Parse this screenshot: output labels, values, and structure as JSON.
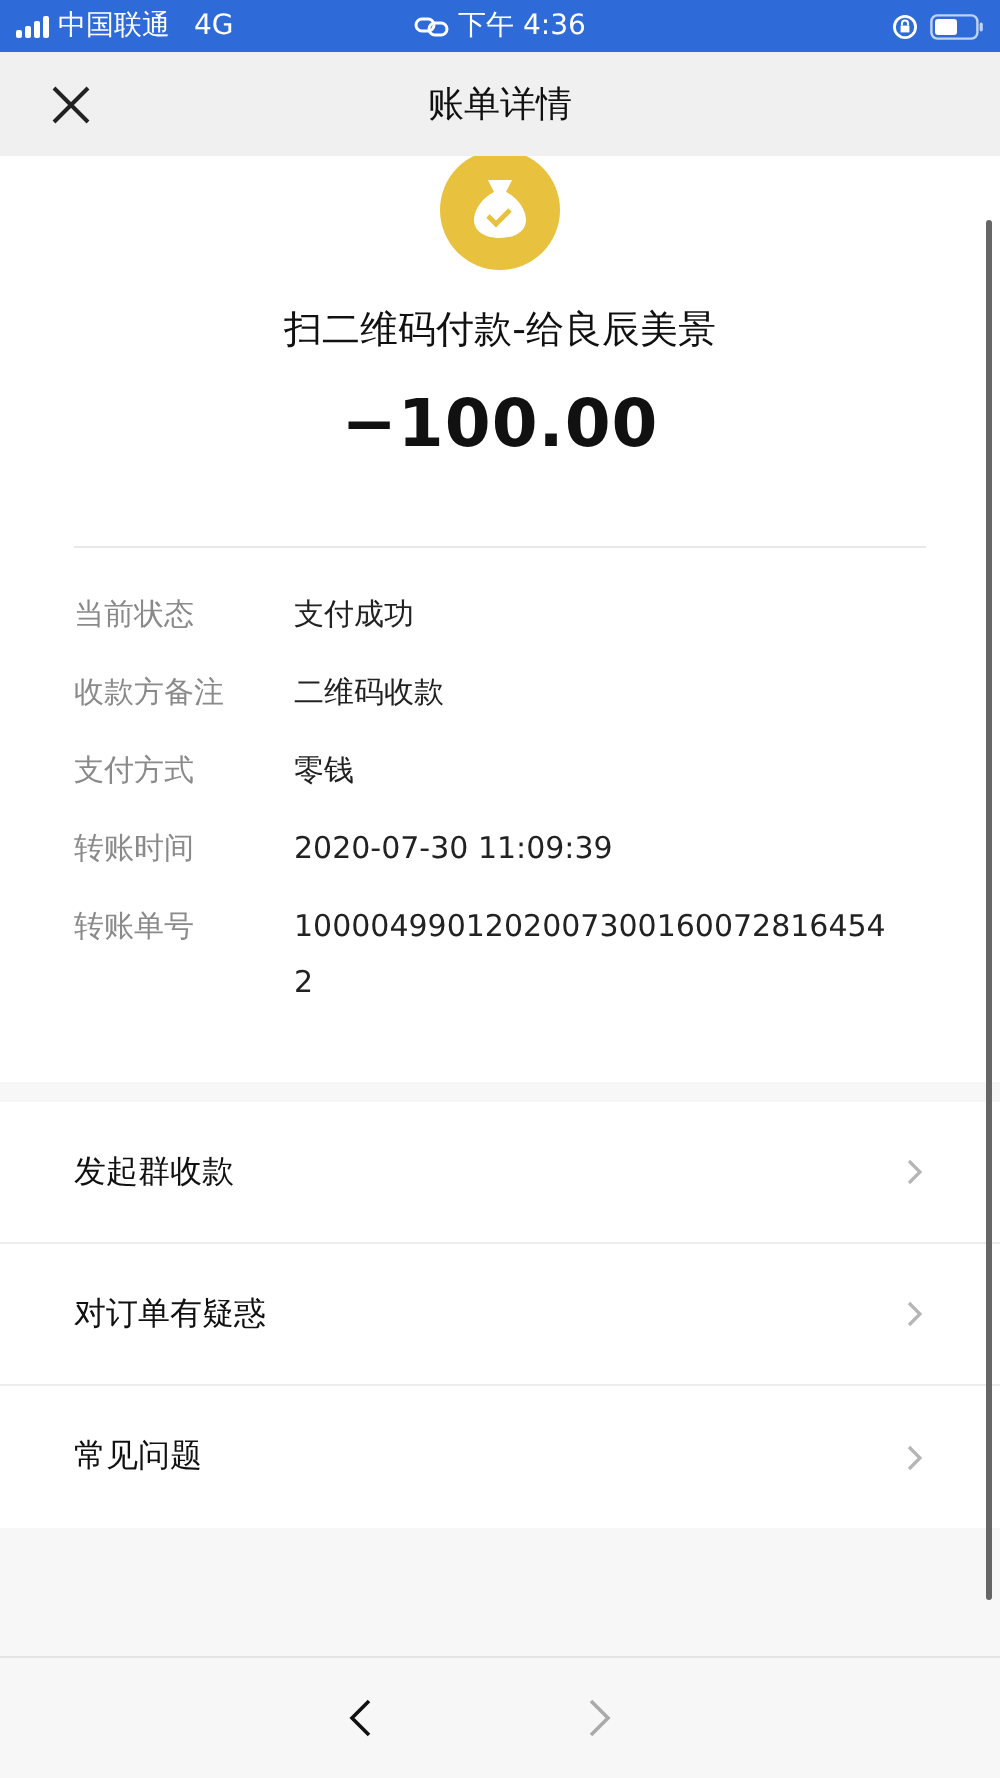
{
  "status_bar": {
    "carrier": "中国联通",
    "network": "4G",
    "time": "下午 4:36"
  },
  "nav_bar": {
    "title": "账单详情"
  },
  "summary": {
    "merchant": "扫二维码付款-给良辰美景",
    "amount": "−100.00"
  },
  "details": [
    {
      "label": "当前状态",
      "value": "支付成功"
    },
    {
      "label": "收款方备注",
      "value": "二维码收款"
    },
    {
      "label": "支付方式",
      "value": "零钱"
    },
    {
      "label": "转账时间",
      "value": "2020-07-30 11:09:39"
    },
    {
      "label": "转账单号",
      "value": "10000499012020073001600728164542"
    }
  ],
  "menu": [
    {
      "label": "发起群收款"
    },
    {
      "label": "对订单有疑惑"
    },
    {
      "label": "常见问题"
    }
  ],
  "toolbar": {
    "back": {
      "disabled": false
    },
    "forward": {
      "disabled": true
    }
  }
}
